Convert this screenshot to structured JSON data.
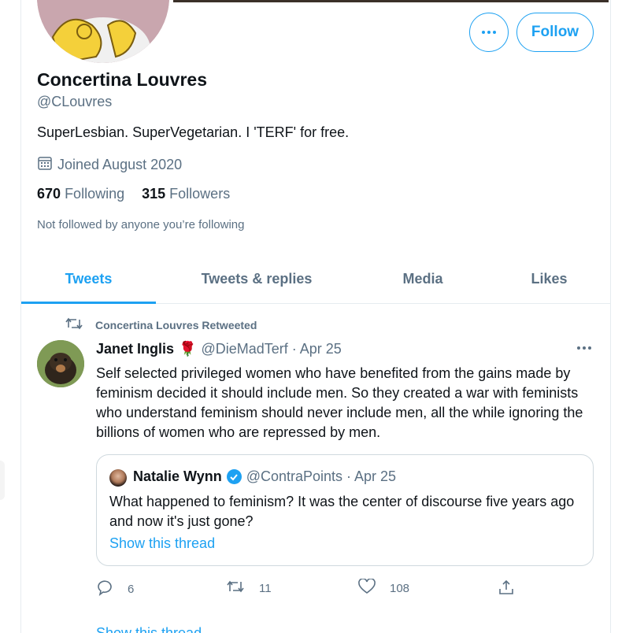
{
  "profile": {
    "display_name": "Concertina Louvres",
    "handle": "@CLouvres",
    "bio": "SuperLesbian. SuperVegetarian. I 'TERF' for free.",
    "joined": "Joined August 2020",
    "following_count": "670",
    "following_label": "Following",
    "followers_count": "315",
    "followers_label": "Followers",
    "not_followed": "Not followed by anyone you’re following",
    "follow_label": "Follow"
  },
  "tabs": [
    {
      "label": "Tweets",
      "active": true
    },
    {
      "label": "Tweets & replies",
      "active": false
    },
    {
      "label": "Media",
      "active": false
    },
    {
      "label": "Likes",
      "active": false
    }
  ],
  "tweet": {
    "retweeted_by": "Concertina Louvres Retweeted",
    "author": "Janet Inglis",
    "author_emoji": "🌹",
    "handle_date": "@DieMadTerf · Apr 25",
    "text": "Self selected privileged women who have benefited from the gains made by feminism decided it should include men. So they created a war with feminists who understand feminism should never include men, all the while ignoring the billions of women who are repressed by men.",
    "quote": {
      "author": "Natalie Wynn",
      "handle_date": "@ContraPoints · Apr 25",
      "text": "What happened to feminism? It was the center of discourse five years ago and now it's just gone?",
      "show_thread": "Show this thread"
    },
    "replies": "6",
    "retweets": "11",
    "likes": "108",
    "show_thread": "Show this thread"
  },
  "colors": {
    "accent": "#1da1f2",
    "secondary_text": "#5b7083",
    "primary_text": "#0f1419",
    "border": "#e6ecf0"
  }
}
